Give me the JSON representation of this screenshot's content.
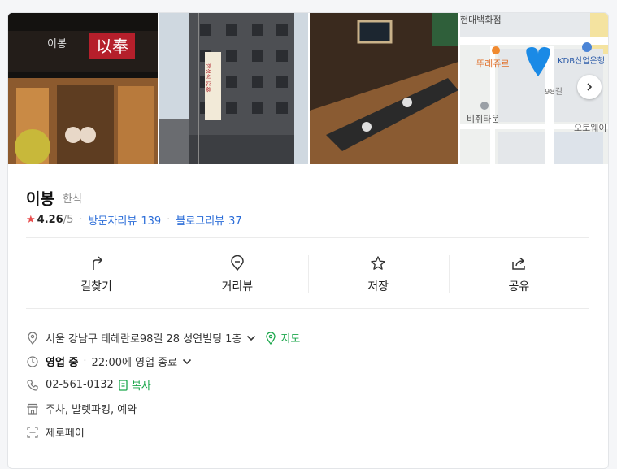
{
  "place": {
    "name": "이봉",
    "category": "한식"
  },
  "rating": {
    "value": "4.26",
    "max": "/5",
    "visitor_label": "방문자리뷰",
    "visitor_count": "139",
    "blog_label": "블로그리뷰",
    "blog_count": "37"
  },
  "photos": {
    "sign_hangul": "이봉",
    "sign_hanja": "以奉",
    "building_sign": "한정식 以奉"
  },
  "map": {
    "labels": [
      "현대백화점",
      "뚜레쥬르",
      "KDB산업은행",
      "98길",
      "비취타운",
      "오토웨이"
    ]
  },
  "actions": [
    {
      "label": "길찾기",
      "icon": "directions-icon"
    },
    {
      "label": "거리뷰",
      "icon": "streetview-icon"
    },
    {
      "label": "저장",
      "icon": "star-icon"
    },
    {
      "label": "공유",
      "icon": "share-icon"
    }
  ],
  "info": {
    "address": "서울 강남구 테헤란로98길 28 성연빌딩 1층",
    "map_link": "지도",
    "status": "영업 중",
    "hours": "22:00에 영업 종료",
    "phone": "02-561-0132",
    "copy": "복사",
    "facilities": "주차, 발렛파킹, 예약",
    "pay": "제로페이"
  },
  "colors": {
    "accent_blue": "#2a6cd8",
    "accent_green": "#1aa64a",
    "star_red": "#e84f4f",
    "map_pin": "#1a8ae6"
  }
}
